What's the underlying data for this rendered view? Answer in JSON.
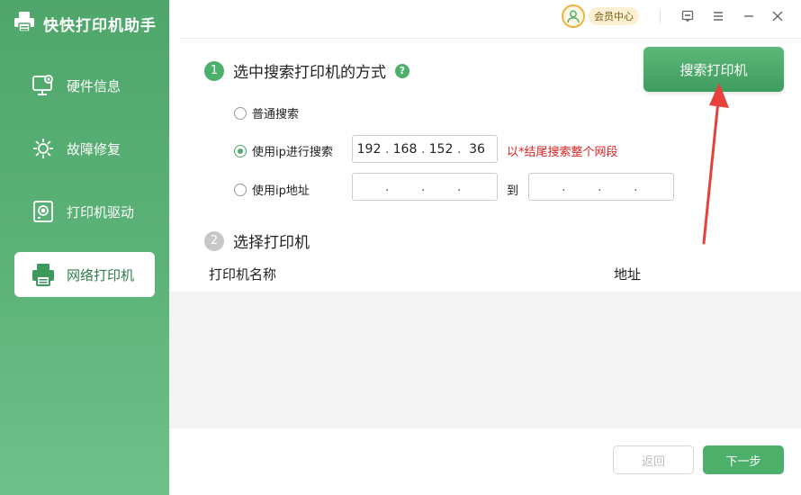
{
  "app": {
    "title": "快快打印机助手"
  },
  "sidebar": {
    "items": [
      {
        "label": "硬件信息",
        "icon": "monitor-icon",
        "active": false
      },
      {
        "label": "故障修复",
        "icon": "wrench-gear-icon",
        "active": false
      },
      {
        "label": "打印机驱动",
        "icon": "disk-drive-icon",
        "active": false
      },
      {
        "label": "网络打印机",
        "icon": "printer-icon",
        "active": true
      }
    ]
  },
  "topbar": {
    "member_label": "会员中心",
    "icons": [
      "feedback-icon",
      "menu-icon",
      "minimize-icon",
      "close-icon"
    ]
  },
  "step1": {
    "number": "1",
    "title": "选中搜索打印机的方式",
    "help": "?",
    "search_button": "搜索打印机",
    "options": [
      {
        "label": "普通搜索",
        "checked": false
      },
      {
        "label": "使用ip进行搜索",
        "checked": true
      },
      {
        "label": "使用ip地址",
        "checked": false
      }
    ],
    "ip_search": {
      "segments": [
        "192",
        "168",
        "152",
        "36"
      ],
      "hint": "以*结尾搜索整个网段"
    },
    "ip_range": {
      "from": [
        "",
        "",
        "",
        ""
      ],
      "to_label": "到",
      "to": [
        "",
        "",
        "",
        ""
      ]
    }
  },
  "step2": {
    "number": "2",
    "title": "选择打印机",
    "columns": [
      "打印机名称",
      "地址"
    ]
  },
  "footer": {
    "back_label": "返回",
    "next_label": "下一步"
  },
  "colors": {
    "accent": "#4caf6a",
    "sidebar": "#5cb378",
    "hint": "#e02020",
    "arrow": "#e8403a"
  }
}
